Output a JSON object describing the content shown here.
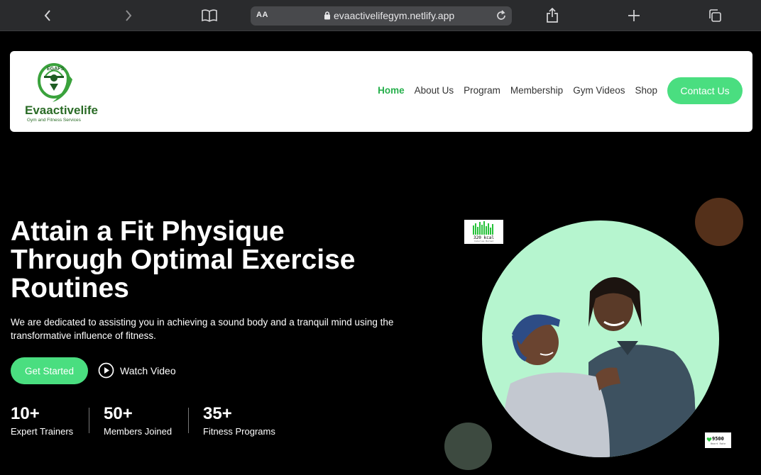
{
  "browser": {
    "aa_label": "AA",
    "url": "evaactivelifegym.netlify.app"
  },
  "nav": {
    "logo_top_text": "EGAFS",
    "logo_brand": "Evaactivelife",
    "logo_tagline": "Gym and Fitness Services",
    "links": [
      "Home",
      "About Us",
      "Program",
      "Membership",
      "Gym Videos",
      "Shop"
    ],
    "contact_label": "Contact Us",
    "accent": "#4ade80"
  },
  "hero": {
    "title_line1": "Attain a Fit Physique",
    "title_line2": "Through Optimal Exercise",
    "title_line3": "Routines",
    "subtitle": "We are dedicated to assisting you in achieving a sound body and a tranquil mind using the transformative influence of fitness.",
    "get_started_label": "Get Started",
    "watch_video_label": "Watch Video",
    "stats": [
      {
        "num": "10+",
        "label": "Expert Trainers"
      },
      {
        "num": "50+",
        "label": "Members Joined"
      },
      {
        "num": "35+",
        "label": "Fitness Programs"
      }
    ],
    "kcal_text": "320 kcal",
    "kcal_sub": "Calories Burned",
    "steps_text": "9500",
    "steps_sub": "Heart Rate"
  }
}
